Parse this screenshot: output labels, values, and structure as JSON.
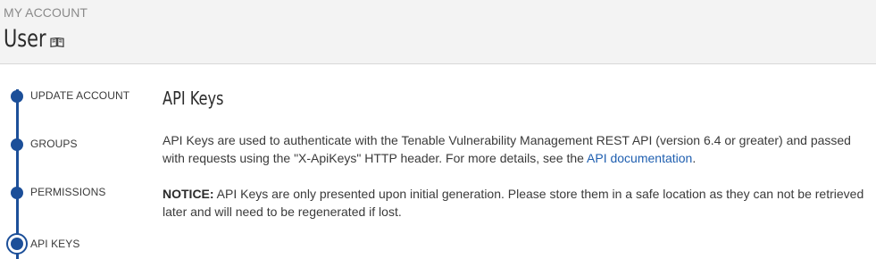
{
  "header": {
    "eyebrow": "MY ACCOUNT",
    "title": "User",
    "title_icon": "book-icon"
  },
  "stepper": {
    "items": [
      {
        "label": "UPDATE ACCOUNT",
        "active": false
      },
      {
        "label": "GROUPS",
        "active": false
      },
      {
        "label": "PERMISSIONS",
        "active": false
      },
      {
        "label": "API KEYS",
        "active": true
      }
    ],
    "accent_color": "#1c4f99"
  },
  "main": {
    "section_title": "API Keys",
    "description": {
      "before_link": "API Keys are used to authenticate with the Tenable Vulnerability Management REST API (version 6.4 or greater) and passed with requests using the \"X-ApiKeys\" HTTP header. For more details, see the ",
      "link_text": "API documentation",
      "after_link": "."
    },
    "notice": {
      "label": "NOTICE:",
      "text": " API Keys are only presented upon initial generation. Please store them in a safe location as they can not be retrieved later and will need to be regenerated if lost."
    }
  },
  "colors": {
    "header_bg": "#f3f3f3",
    "link": "#1f5fb0",
    "accent": "#1c4f99"
  }
}
